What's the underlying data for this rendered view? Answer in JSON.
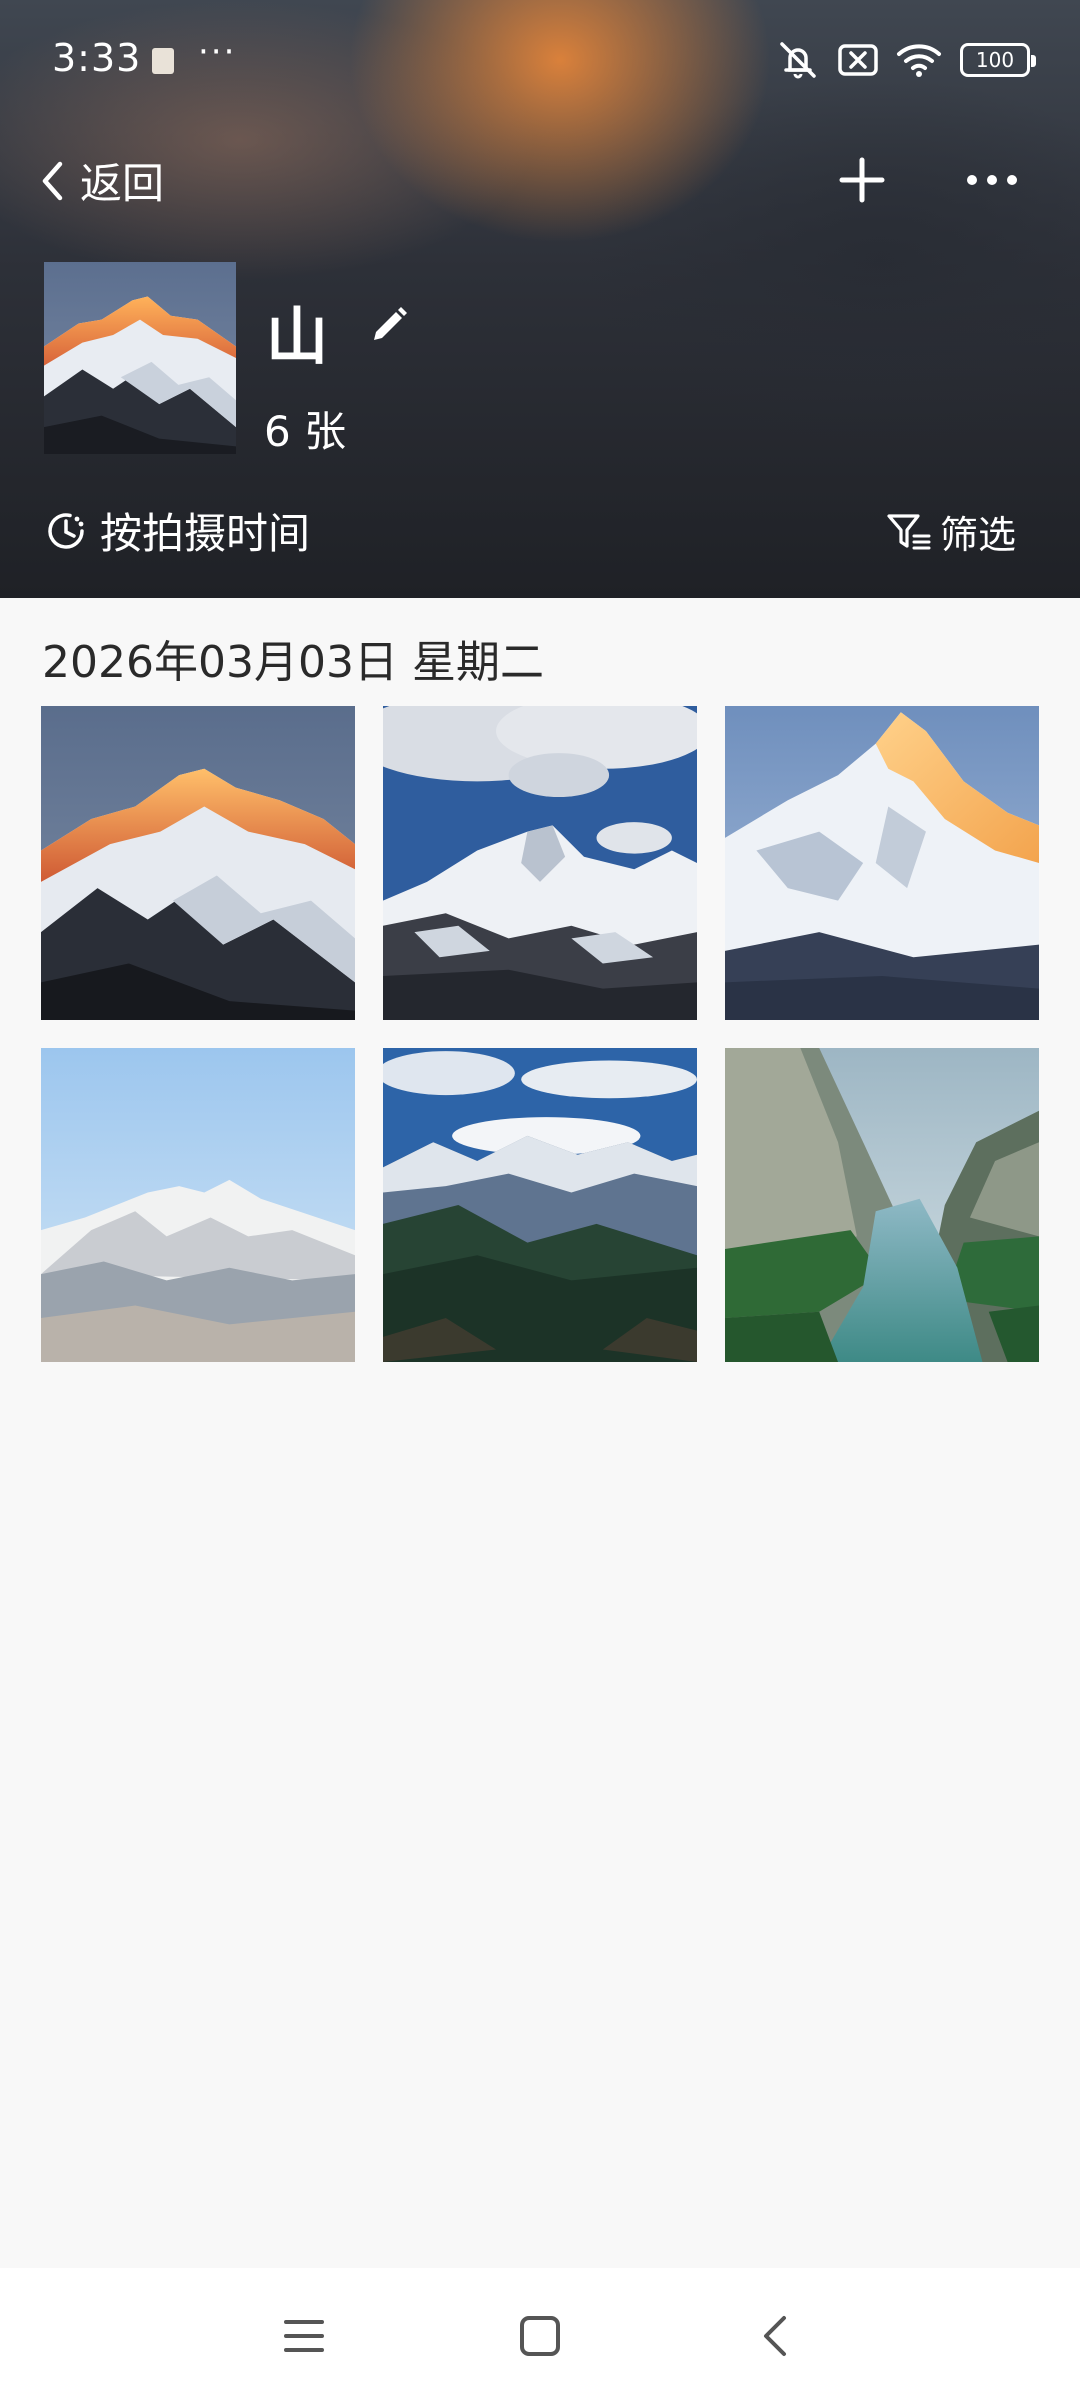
{
  "status_bar": {
    "time": "3:33",
    "more": "···",
    "battery": "100",
    "icons": [
      "note-icon",
      "mute-icon",
      "sim-off-icon",
      "wifi-icon",
      "battery-icon"
    ]
  },
  "nav": {
    "back_label": "返回",
    "add_icon": "plus-icon",
    "more_icon": "more-horizontal-icon"
  },
  "album": {
    "title": "山",
    "count": "6 张",
    "sort_label": "按拍摄时间",
    "filter_label": "筛选"
  },
  "content": {
    "date_header": "2026年03月03日 星期二",
    "photos": [
      {
        "subject": "sunset-lit-peak"
      },
      {
        "subject": "snow-peak-blue-sky-clouds"
      },
      {
        "subject": "golden-summit-snow-slopes"
      },
      {
        "subject": "snow-range-pale-sky"
      },
      {
        "subject": "snow-range-forest-valley"
      },
      {
        "subject": "canyon-river-green-cliffs"
      }
    ]
  },
  "system_nav": {
    "icons": [
      "menu-icon",
      "home-icon",
      "back-icon"
    ]
  },
  "colors": {
    "header_bg": "#2d3038",
    "header_glow": "#e2843a",
    "content_bg": "#f8f8f8",
    "text_dark": "#2a2a2a",
    "navbar_bg": "#ffffff"
  }
}
